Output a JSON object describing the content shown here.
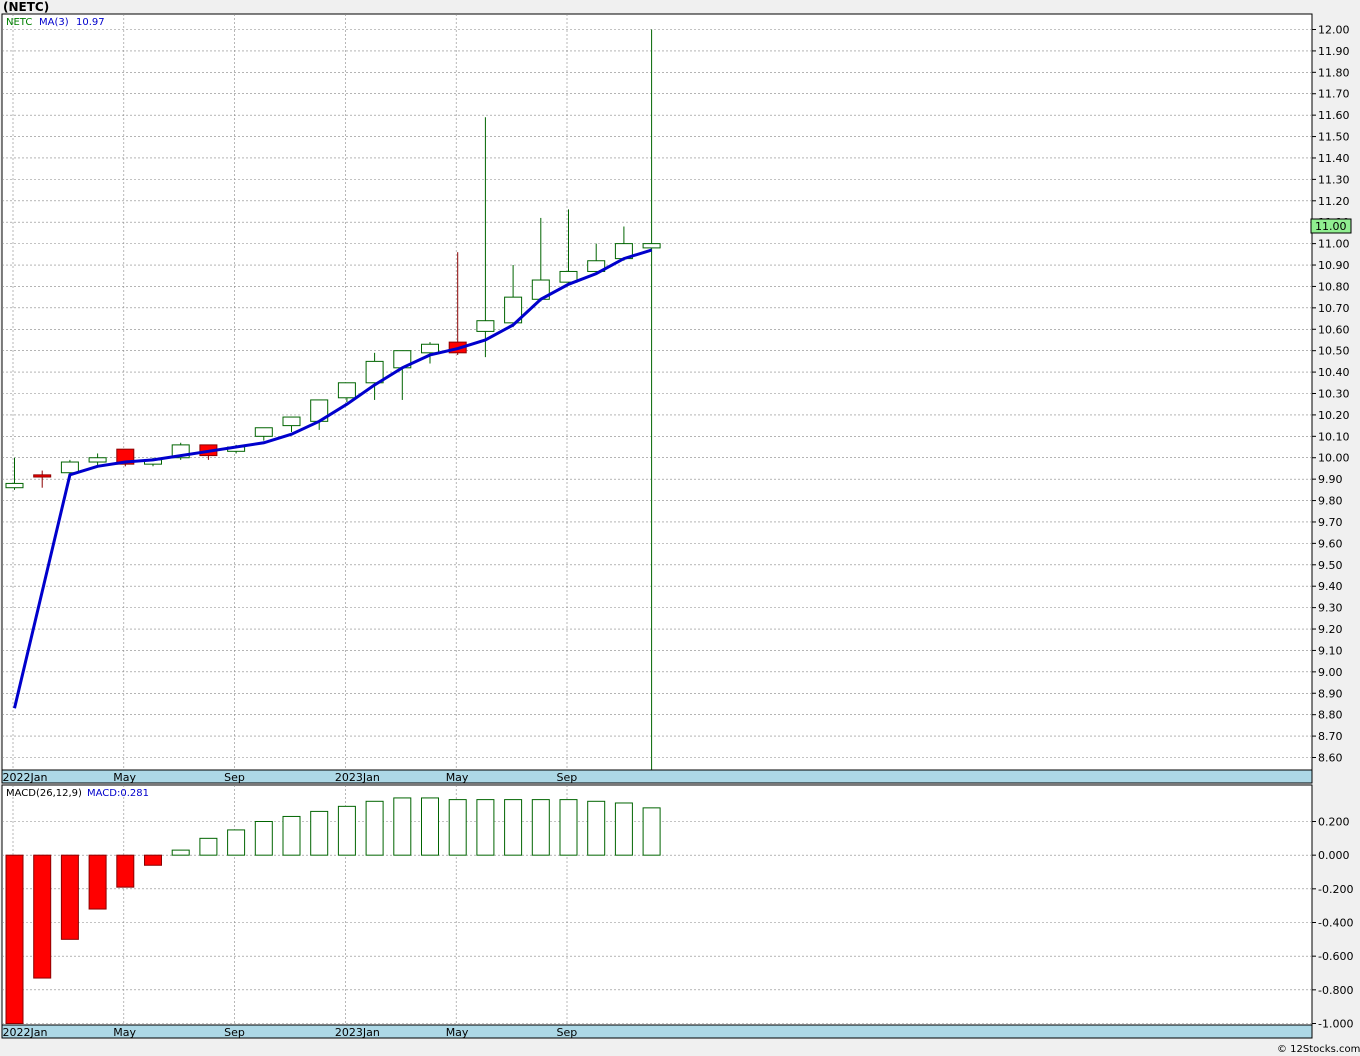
{
  "header": {
    "title": "(NETC)",
    "footer": "© 12Stocks.com"
  },
  "legend": {
    "symbol": "NETC",
    "ma_label": "MA(3)",
    "ma_value": "10.97",
    "macd_label": "MACD(26,12,9)",
    "macd_value": "MACD:0.281"
  },
  "colors": {
    "up": "#006400",
    "down": "#ff0000",
    "ma": "#0000cc",
    "grid": "#888888",
    "axis_band": "#add8e6",
    "last_price_box": "#90ee90"
  },
  "chart_data": [
    {
      "type": "candlestick",
      "title": "(NETC)",
      "x_tick_labels": [
        "2022Jan",
        "May",
        "Sep",
        "2023Jan",
        "May",
        "Sep"
      ],
      "y_tick_labels": [
        "8.60",
        "8.70",
        "8.80",
        "8.90",
        "9.00",
        "9.10",
        "9.20",
        "9.30",
        "9.40",
        "9.50",
        "9.60",
        "9.70",
        "9.80",
        "9.90",
        "10.00",
        "10.10",
        "10.20",
        "10.30",
        "10.40",
        "10.50",
        "10.60",
        "10.70",
        "10.80",
        "10.90",
        "11.00",
        "11.10",
        "11.20",
        "11.30",
        "11.40",
        "11.50",
        "11.60",
        "11.70",
        "11.80",
        "11.90",
        "12.00"
      ],
      "ylim": [
        8.53,
        12.08
      ],
      "grid": true,
      "last_price": "11.00",
      "series": [
        {
          "name": "NETC",
          "type": "ohlc",
          "dates": [
            "2022-01",
            "2022-02",
            "2022-03",
            "2022-04",
            "2022-05",
            "2022-06",
            "2022-07",
            "2022-08",
            "2022-09",
            "2022-10",
            "2022-11",
            "2022-12",
            "2023-01",
            "2023-02",
            "2023-03",
            "2023-04",
            "2023-05",
            "2023-06",
            "2023-07",
            "2023-08",
            "2023-09",
            "2023-10",
            "2023-11",
            "2023-12"
          ],
          "open": [
            9.86,
            9.92,
            9.93,
            9.98,
            10.04,
            9.97,
            10.0,
            10.06,
            10.03,
            10.1,
            10.15,
            10.17,
            10.28,
            10.35,
            10.42,
            10.49,
            10.54,
            10.59,
            10.63,
            10.74,
            10.82,
            10.87,
            10.93,
            10.98
          ],
          "high": [
            10.0,
            9.94,
            9.99,
            10.02,
            10.04,
            10.0,
            10.07,
            10.06,
            10.06,
            10.14,
            10.19,
            10.27,
            10.35,
            10.49,
            10.5,
            10.54,
            10.96,
            11.59,
            10.9,
            11.12,
            11.16,
            11.0,
            11.08,
            12.0
          ],
          "low": [
            9.85,
            9.86,
            9.92,
            9.96,
            9.96,
            9.96,
            9.99,
            9.99,
            10.02,
            10.08,
            10.12,
            10.13,
            10.26,
            10.27,
            10.27,
            10.44,
            10.48,
            10.47,
            10.61,
            10.73,
            10.81,
            10.86,
            10.92,
            8.53
          ],
          "close": [
            9.88,
            9.91,
            9.98,
            10.0,
            9.97,
            9.99,
            10.06,
            10.01,
            10.05,
            10.14,
            10.19,
            10.27,
            10.35,
            10.45,
            10.5,
            10.53,
            10.49,
            10.64,
            10.75,
            10.83,
            10.87,
            10.92,
            11.0,
            11.0
          ]
        },
        {
          "name": "MA(3)",
          "type": "line",
          "values": [
            8.83,
            null,
            9.92,
            9.96,
            9.98,
            9.99,
            10.01,
            10.03,
            10.05,
            10.07,
            10.11,
            10.17,
            10.25,
            10.34,
            10.42,
            10.48,
            10.51,
            10.55,
            10.62,
            10.74,
            10.81,
            10.86,
            10.93,
            10.97
          ]
        }
      ]
    },
    {
      "type": "bar",
      "title": "MACD(26,12,9)",
      "x_tick_labels": [
        "2022Jan",
        "May",
        "Sep",
        "2023Jan",
        "May",
        "Sep"
      ],
      "y_tick_labels": [
        "0.200",
        "0.000",
        "-0.200",
        "-0.400",
        "-0.600",
        "-0.800",
        "-1.000"
      ],
      "ylim": [
        -1.01,
        0.4
      ],
      "grid": true,
      "series": [
        {
          "name": "MACD",
          "values": [
            -1.0,
            -0.73,
            -0.5,
            -0.32,
            -0.19,
            -0.06,
            0.03,
            0.1,
            0.15,
            0.2,
            0.23,
            0.26,
            0.29,
            0.32,
            0.34,
            0.34,
            0.33,
            0.33,
            0.33,
            0.33,
            0.33,
            0.32,
            0.31,
            0.281
          ]
        }
      ]
    }
  ]
}
